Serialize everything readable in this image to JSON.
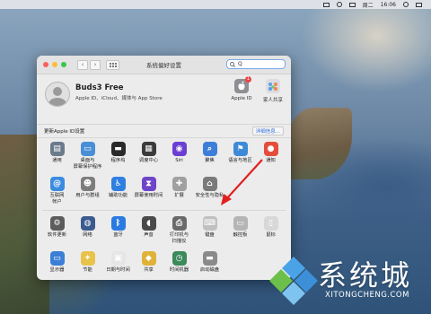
{
  "menubar": {
    "day": "周二",
    "time": "16:06"
  },
  "window": {
    "title": "系统偏好设置",
    "search_value": "Q"
  },
  "account": {
    "name": "Buds3 Free",
    "subtitle": "Apple ID、iCloud、媒体与 App Store",
    "apple_id_label": "Apple ID",
    "apple_id_badge": "1",
    "family_label": "家人共享"
  },
  "update": {
    "text": "更新Apple ID设置",
    "link": "详细信息..."
  },
  "rows": [
    [
      {
        "label": "通用",
        "icon": "general-icon",
        "color": "#6b7b8c",
        "glyph": "▤"
      },
      {
        "label": "桌面与\n屏幕保护程序",
        "icon": "desktop-screensaver-icon",
        "color": "#4a8ed6",
        "glyph": "▭"
      },
      {
        "label": "程序坞",
        "icon": "dock-icon",
        "color": "#2a2a2a",
        "glyph": "▬"
      },
      {
        "label": "调度中心",
        "icon": "mission-control-icon",
        "color": "#3a3a3a",
        "glyph": "▦"
      },
      {
        "label": "Siri",
        "icon": "siri-icon",
        "color": "#6b3fd1",
        "glyph": "◉"
      },
      {
        "label": "聚焦",
        "icon": "spotlight-icon",
        "color": "#3d7fd8",
        "glyph": "⌕"
      },
      {
        "label": "语言与地区",
        "icon": "language-region-icon",
        "color": "#3e8ad8",
        "glyph": "⚑"
      },
      {
        "label": "通知",
        "icon": "notifications-icon",
        "color": "#e44c3c",
        "glyph": "●"
      }
    ],
    [
      {
        "label": "互联网\n帐户",
        "icon": "internet-accounts-icon",
        "color": "#3b8be0",
        "glyph": "@"
      },
      {
        "label": "用户与群组",
        "icon": "users-groups-icon",
        "color": "#7d7d7d",
        "glyph": "☻"
      },
      {
        "label": "辅助功能",
        "icon": "accessibility-icon",
        "color": "#2f7fe0",
        "glyph": "♿"
      },
      {
        "label": "屏幕使用时间",
        "icon": "screen-time-icon",
        "color": "#6e45c8",
        "glyph": "⧗"
      },
      {
        "label": "扩展",
        "icon": "extensions-icon",
        "color": "#a0a0a0",
        "glyph": "✚"
      },
      {
        "label": "安全性与隐私",
        "icon": "security-privacy-icon",
        "color": "#7a7a7a",
        "glyph": "⌂"
      }
    ],
    [
      {
        "label": "软件更新",
        "icon": "software-update-icon",
        "color": "#5c5c5c",
        "glyph": "⚙"
      },
      {
        "label": "网络",
        "icon": "network-icon",
        "color": "#3b5b8f",
        "glyph": "◍"
      },
      {
        "label": "蓝牙",
        "icon": "bluetooth-icon",
        "color": "#2a7ae0",
        "glyph": "ᛒ"
      },
      {
        "label": "声音",
        "icon": "sound-icon",
        "color": "#4a4a4a",
        "glyph": "◖"
      },
      {
        "label": "打印机与\n扫描仪",
        "icon": "printers-scanners-icon",
        "color": "#6a6a6a",
        "glyph": "⎙"
      },
      {
        "label": "键盘",
        "icon": "keyboard-icon",
        "color": "#c0c0c0",
        "glyph": "⌨"
      },
      {
        "label": "触控板",
        "icon": "trackpad-icon",
        "color": "#b5b5b5",
        "glyph": "▭"
      },
      {
        "label": "鼠标",
        "icon": "mouse-icon",
        "color": "#d8d8d8",
        "glyph": "▯"
      }
    ],
    [
      {
        "label": "显示器",
        "icon": "displays-icon",
        "color": "#3b7fd6",
        "glyph": "▭"
      },
      {
        "label": "节能",
        "icon": "energy-saver-icon",
        "color": "#e8c34a",
        "glyph": "✦"
      },
      {
        "label": "日期与时间",
        "icon": "date-time-icon",
        "color": "#e6e6e6",
        "glyph": "▣"
      },
      {
        "label": "共享",
        "icon": "sharing-icon",
        "color": "#e0b23a",
        "glyph": "◆"
      },
      {
        "label": "时间机器",
        "icon": "time-machine-icon",
        "color": "#3a8a5a",
        "glyph": "◷"
      },
      {
        "label": "启动磁盘",
        "icon": "startup-disk-icon",
        "color": "#8a8a8a",
        "glyph": "▬"
      }
    ]
  ],
  "watermark": {
    "cn": "系统城",
    "en": "XITONGCHENG.COM"
  }
}
